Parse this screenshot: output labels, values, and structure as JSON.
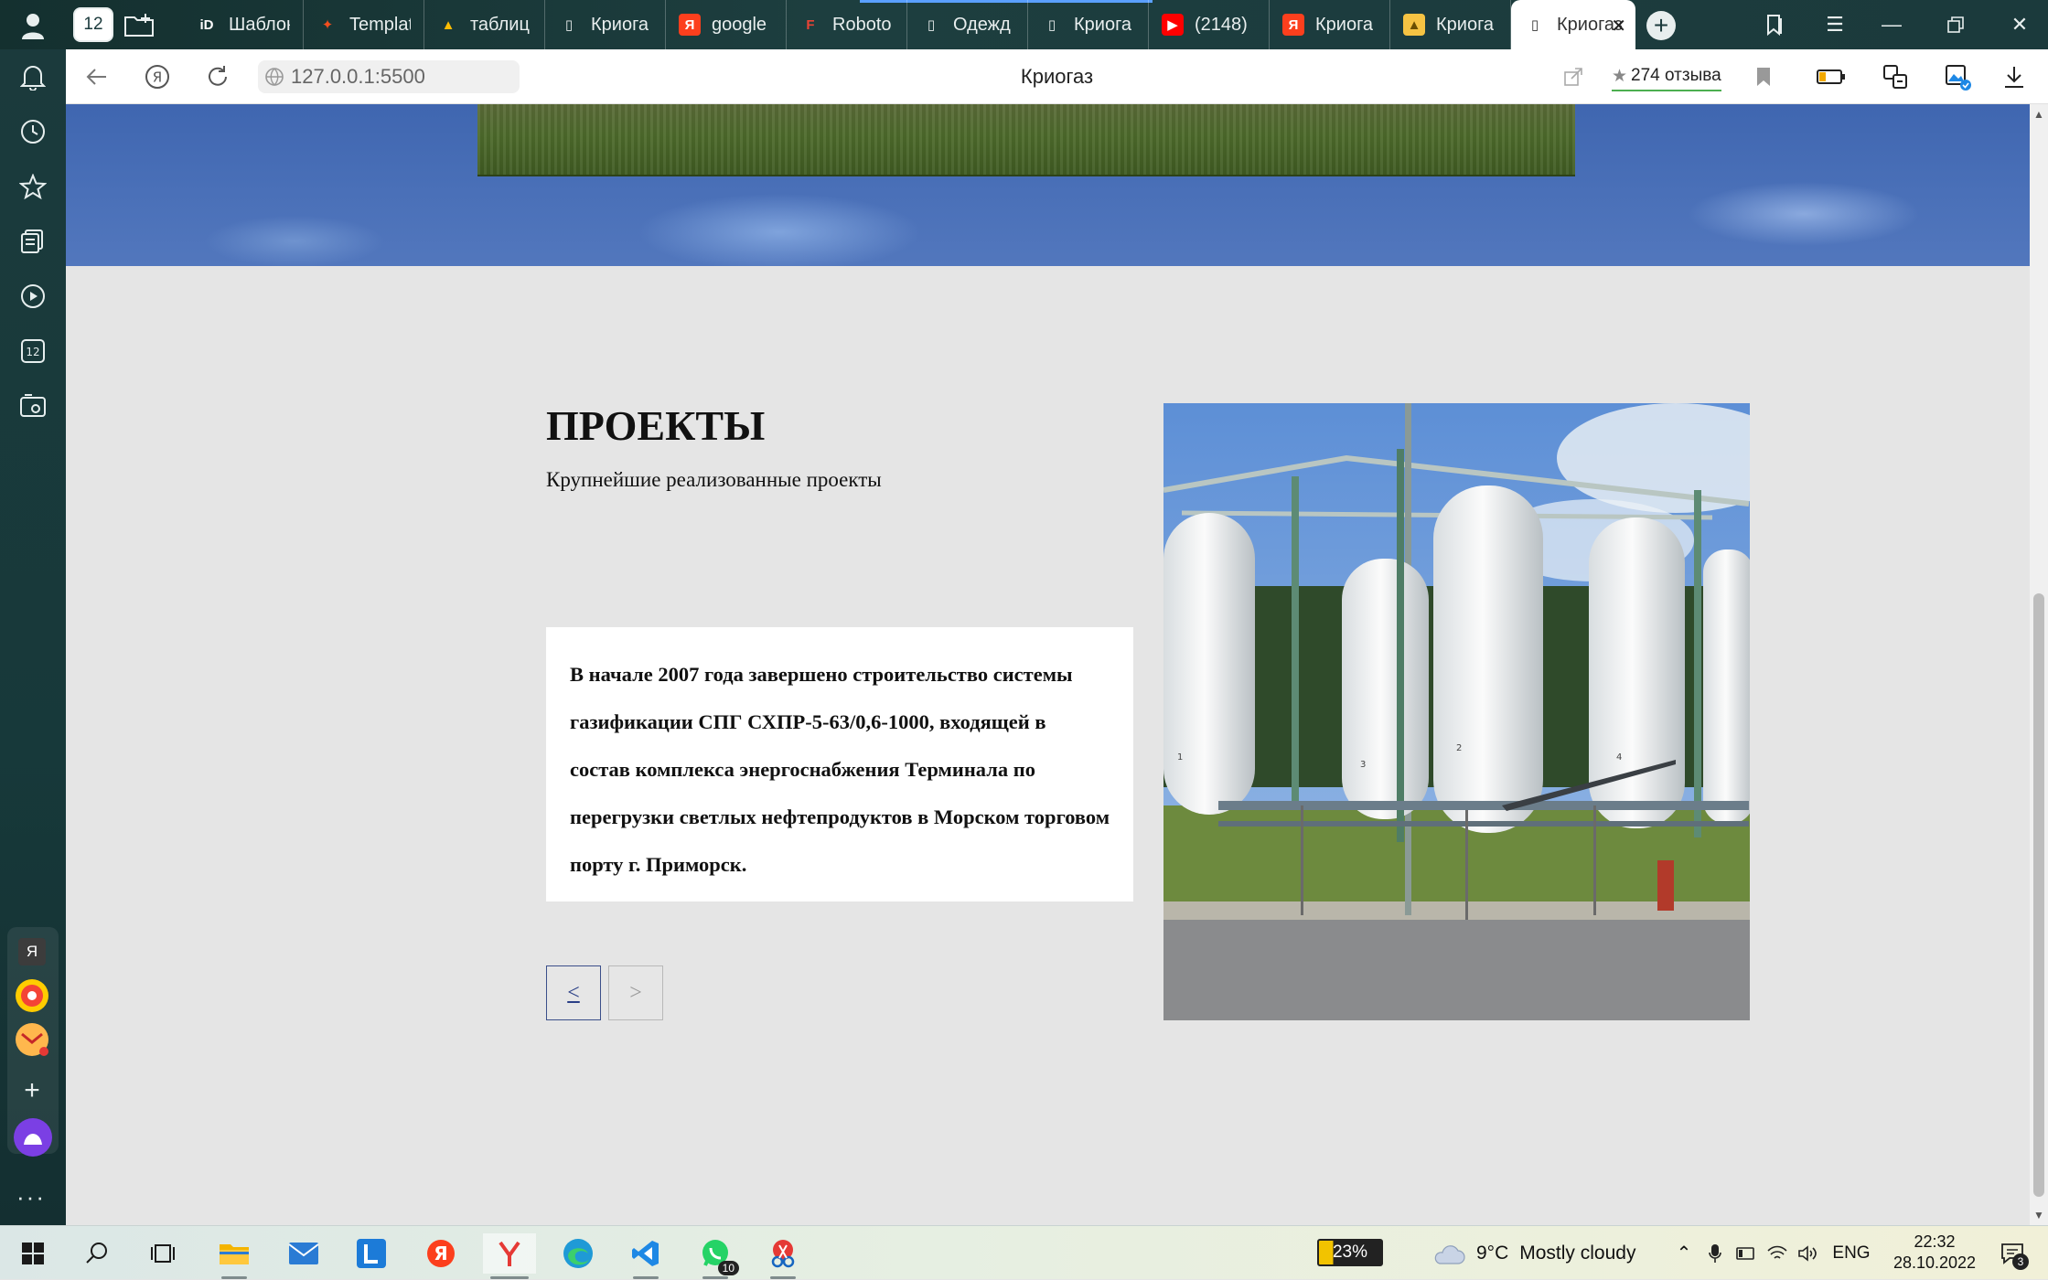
{
  "browser": {
    "tab_count": "12",
    "tabs": [
      {
        "label": "Шаблон",
        "icon": "id-logo-icon"
      },
      {
        "label": "Templat",
        "icon": "figma-icon"
      },
      {
        "label": "таблиц",
        "icon": "google-drive-icon"
      },
      {
        "label": "Криога",
        "icon": "page-icon"
      },
      {
        "label": "google",
        "icon": "yandex-icon"
      },
      {
        "label": "Roboto",
        "icon": "fonts-icon"
      },
      {
        "label": "Одежд",
        "icon": "page-icon"
      },
      {
        "label": "Криога",
        "icon": "page-icon"
      },
      {
        "label": "(2148)",
        "icon": "youtube-icon"
      },
      {
        "label": "Криога",
        "icon": "yandex-icon"
      },
      {
        "label": "Криога",
        "icon": "image-icon"
      }
    ],
    "active_tab": {
      "label": "Криогаз",
      "icon": "page-icon"
    },
    "url": "127.0.0.1:5500",
    "page_title": "Криогаз",
    "reviews": "274 отзыва"
  },
  "page": {
    "projects_title": "ПРОЕКТЫ",
    "projects_subtitle": "Крупнейшие реализованные проекты",
    "project_text": "В начале 2007 года завершено строительство системы газификации СПГ СХПР-5-63/0,6-1000, входящей в состав комплекса энергоснабжения Терминала по перегрузки светлых нефтепродуктов в Морском торговом порту г. Приморск.",
    "prev_label": "<",
    "next_label": ">",
    "tank_labels": [
      "1",
      "2",
      "3",
      "4"
    ]
  },
  "sidebar": {
    "yandex_app_letter": "Я"
  },
  "taskbar": {
    "battery": "23%",
    "weather_temp": "9°C",
    "weather_desc": "Mostly cloudy",
    "lang": "ENG",
    "time": "22:32",
    "date": "28.10.2022",
    "whatsapp_badge": "10",
    "notif_count": "3"
  },
  "colors": {
    "sidebar_bg": "#1b3a3c",
    "hero_blue": "#4a70b8",
    "page_bg": "#e5e5e5",
    "prev_border": "#3b4f8a",
    "reviews_underline": "#4caf50"
  }
}
